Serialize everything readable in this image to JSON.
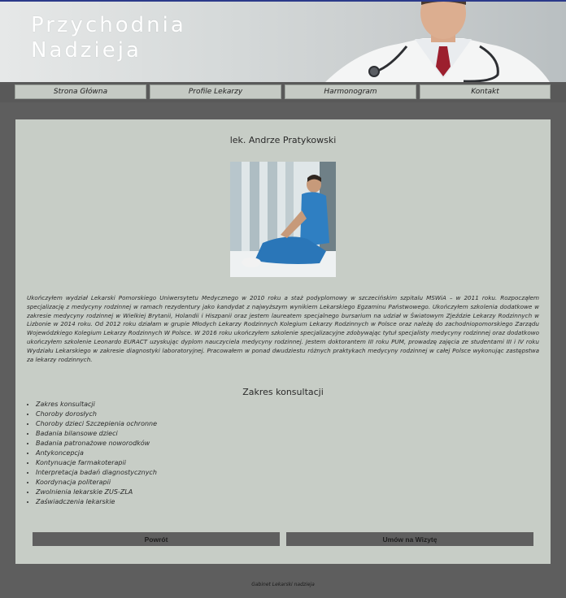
{
  "header": {
    "title_line1": "Przychodnia",
    "title_line2": "Nadzieja"
  },
  "nav": {
    "items": [
      {
        "label": "Strona Główna"
      },
      {
        "label": "Profile Lekarzy"
      },
      {
        "label": "Harmonogram"
      },
      {
        "label": "Kontakt"
      }
    ]
  },
  "doctor": {
    "name": "lek. Andrze Pratykowski",
    "bio": "Ukończyłem wydział Lekarski Pomorskiego Uniwersytetu Medycznego w 2010 roku a staż podyplomowy w szczecińskim szpitalu MSWiA – w 2011 roku. Rozpocząłem specjalizację z medycyny rodzinnej w ramach rezydentury jako kandydat z najwyższym wynikiem Lekarskiego Egzaminu Państwowego. Ukończyłem szkolenia dodatkowe w zakresie medycyny rodzinnej w Wielkiej Brytanii, Holandii i Hiszpanii oraz jestem laureatem specjalnego bursarium na udział w Światowym Zjeździe Lekarzy Rodzinnych w Lizbonie w 2014 roku. Od 2012 roku działam w grupie Młodych Lekarzy Rodzinnych Kolegium Lekarzy Rodzinnych w Polsce oraz należę do zachodniopomorskiego Zarządu Wojewódzkiego Kolegium Lekarzy Rodzinnych W Polsce. W 2016 roku ukończyłem szkolenie specjalizacyjne zdobywając tytuł specjalisty medycyny rodzinnej oraz dodatkowo ukończyłem szkolenie Leonardo EURACT uzyskując dyplom nauczyciela medycyny rodzinnej. Jestem doktorantem III roku PUM, prowadzę zajęcia ze studentami III i IV roku Wydziału Lekarskiego w zakresie diagnostyki laboratoryjnej. Pracowałem w ponad dwudziestu różnych praktykach medycyny rodzinnej w całej Polsce wykonując zastępstwa za lekarzy rodzinnych."
  },
  "consultations": {
    "title": "Zakres konsultacji",
    "items": [
      "Zakres konsultacji",
      "Choroby dorosłych",
      "Choroby dzieci Szczepienia ochronne",
      "Badania bilansowe dzieci",
      "Badania patronażowe noworodków",
      "Antykoncepcja",
      "Kontynuacje farmakoterapii",
      "Interpretacja badań diagnostycznych",
      "Koordynacja politerapii",
      "Zwolnienia lekarskie ZUS-ZLA",
      "Zaświadczenia lekarskie"
    ]
  },
  "buttons": {
    "back_label": "Powrót",
    "appointment_label": "Umów na Wizytę"
  },
  "footer": {
    "text": "Gabinet Lekarski nadzieja"
  },
  "colors": {
    "page_bg": "#5e5e5e",
    "panel_bg": "#c7cdc6",
    "nav_item_bg": "#c5cac4",
    "button_bg": "#5f5f5f"
  }
}
